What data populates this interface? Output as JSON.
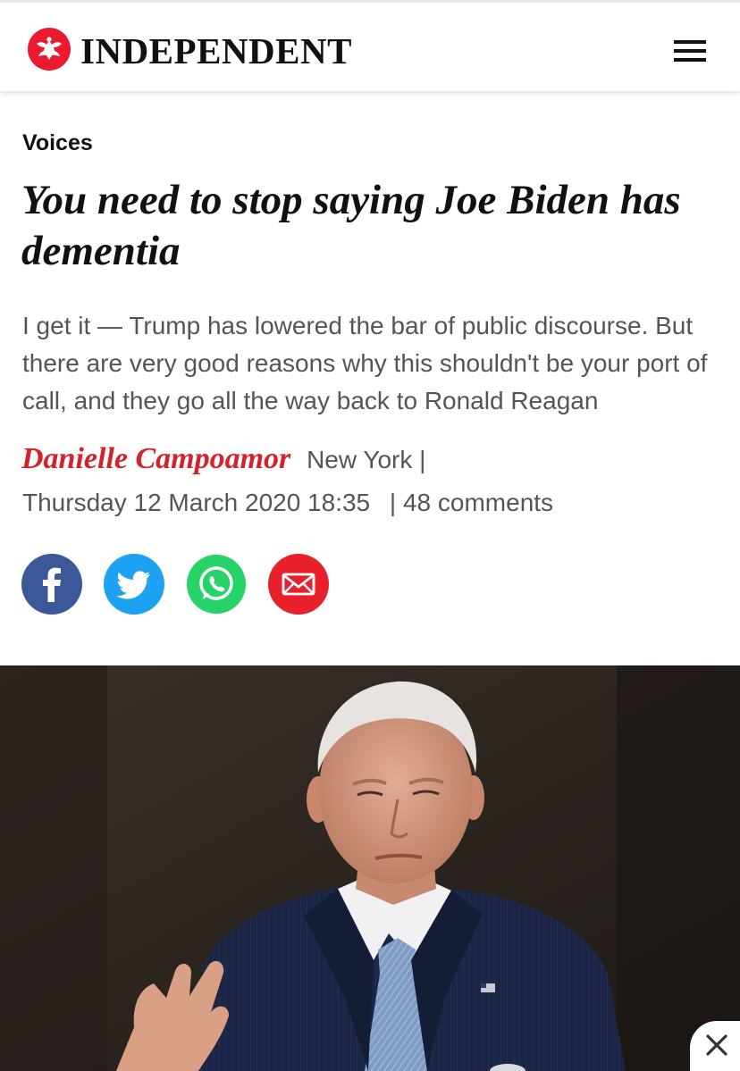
{
  "header": {
    "brand": "INDEPENDENT",
    "logo_icon": "eagle-logo-icon",
    "menu_icon": "hamburger-menu-icon",
    "brand_color": "#ec1a2e"
  },
  "article": {
    "section": "Voices",
    "headline": "You need to stop saying Joe Biden has dementia",
    "standfirst": "I get it — Trump has lowered the bar of public discourse. But there are very good reasons why this shouldn't be your port of call, and they go all the way back to Ronald Reagan",
    "author": "Danielle Campoamor",
    "location": "New York |",
    "date": "Thursday 12 March 2020 18:35",
    "comments": "| 48 comments",
    "author_color": "#d4222d"
  },
  "share": [
    {
      "icon": "facebook-icon",
      "color": "#3b5998"
    },
    {
      "icon": "twitter-icon",
      "color": "#1da1f2"
    },
    {
      "icon": "whatsapp-icon",
      "color": "#25d366"
    },
    {
      "icon": "email-icon",
      "color": "#e8202b"
    }
  ],
  "ad": {
    "close_icon": "close-icon"
  }
}
